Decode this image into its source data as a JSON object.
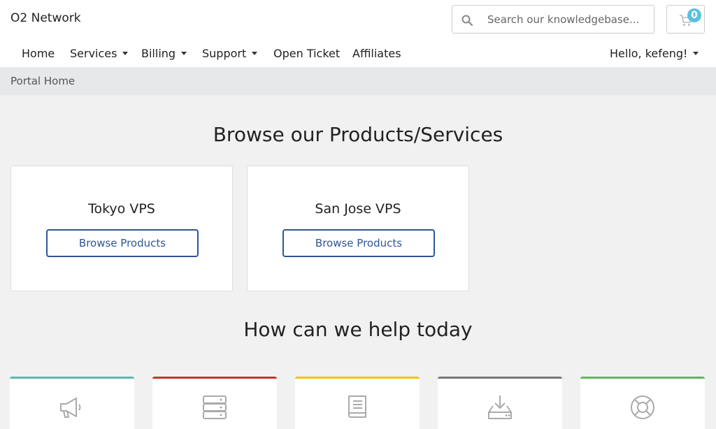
{
  "brand": "O2 Network",
  "search": {
    "placeholder": "Search our knowledgebase..."
  },
  "cart": {
    "count": "0",
    "icon": "cart-icon"
  },
  "nav": {
    "home": "Home",
    "services": "Services",
    "billing": "Billing",
    "support": "Support",
    "open_ticket": "Open Ticket",
    "affiliates": "Affiliates",
    "account": "Hello, kefeng!"
  },
  "breadcrumb": {
    "current": "Portal Home"
  },
  "products": {
    "title": "Browse our Products/Services",
    "items": [
      {
        "name": "Tokyo VPS",
        "button": "Browse Products"
      },
      {
        "name": "San Jose VPS",
        "button": "Browse Products"
      }
    ]
  },
  "help": {
    "title": "How can we help today",
    "cards": [
      {
        "icon": "megaphone-icon",
        "accent": "#5bb8b0"
      },
      {
        "icon": "server-icon",
        "accent": "#c0392b"
      },
      {
        "icon": "book-icon",
        "accent": "#f1c40f"
      },
      {
        "icon": "download-icon",
        "accent": "#777777"
      },
      {
        "icon": "lifebuoy-icon",
        "accent": "#5cb85c"
      }
    ]
  },
  "colors": {
    "accent": "#2e5694",
    "badge": "#5bc0de",
    "page_bg": "#f1f1f1",
    "breadcrumb_bg": "#e6e8ea"
  }
}
